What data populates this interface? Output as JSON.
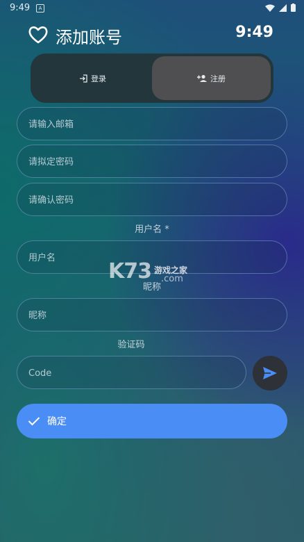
{
  "status_bar": {
    "time": "9:49",
    "notification_badge": "A"
  },
  "header": {
    "title": "添加账号",
    "clock": "9:49"
  },
  "segmented": {
    "login_label": "登录",
    "register_label": "注册",
    "selected": "register"
  },
  "form": {
    "email_placeholder": "请输入邮箱",
    "password_placeholder": "请拟定密码",
    "confirm_password_placeholder": "请确认密码",
    "username_section": "用户名 *",
    "username_placeholder": "用户名",
    "nickname_section": "昵称",
    "nickname_placeholder": "昵称",
    "code_section": "验证码",
    "code_placeholder": "Code"
  },
  "confirm_button": {
    "label": "确定"
  },
  "watermark": {
    "brand": "K73",
    "cn": "游戏之家",
    "domain": ".com"
  },
  "colors": {
    "accent": "#4a8ef5",
    "segment_bg": "#22363c",
    "segment_selected": "#4f4f52",
    "send_button": "#2e3137"
  },
  "icons": {
    "header": "heart-outline-icon",
    "login": "login-icon",
    "register": "person-add-icon",
    "send": "send-icon",
    "confirm": "check-icon"
  }
}
